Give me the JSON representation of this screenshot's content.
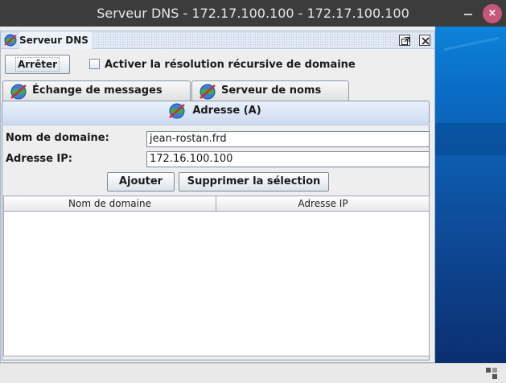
{
  "window": {
    "title": "Serveur DNS - 172.17.100.100 - 172.17.100.100",
    "close_glyph": "×"
  },
  "frame": {
    "title": "Serveur DNS",
    "icon": "globe-network-icon"
  },
  "toolbar": {
    "stop_label": "Arrêter",
    "recursive_label": "Activer la résolution récursive de domaine",
    "recursive_checked": false
  },
  "tabs": [
    {
      "label": "Échange de messages (MX)",
      "icon": "globe-network-icon",
      "active": false
    },
    {
      "label": "Serveur de noms (NS)",
      "icon": "globe-network-icon",
      "active": false
    },
    {
      "label": "Adresse (A)",
      "icon": "globe-network-icon",
      "active": true
    }
  ],
  "form": {
    "domain_label": "Nom de domaine:",
    "domain_value": "jean-rostan.frd",
    "ip_label": "Adresse IP:",
    "ip_value": "172.16.100.100"
  },
  "actions": {
    "add_label": "Ajouter",
    "delete_label": "Supprimer la sélection"
  },
  "table": {
    "columns": [
      "Nom de domaine",
      "Adresse IP"
    ],
    "rows": []
  },
  "colors": {
    "titlebar": "#3c3c3c",
    "close_button": "#c4577a",
    "active_tab": "#cfdcef"
  }
}
